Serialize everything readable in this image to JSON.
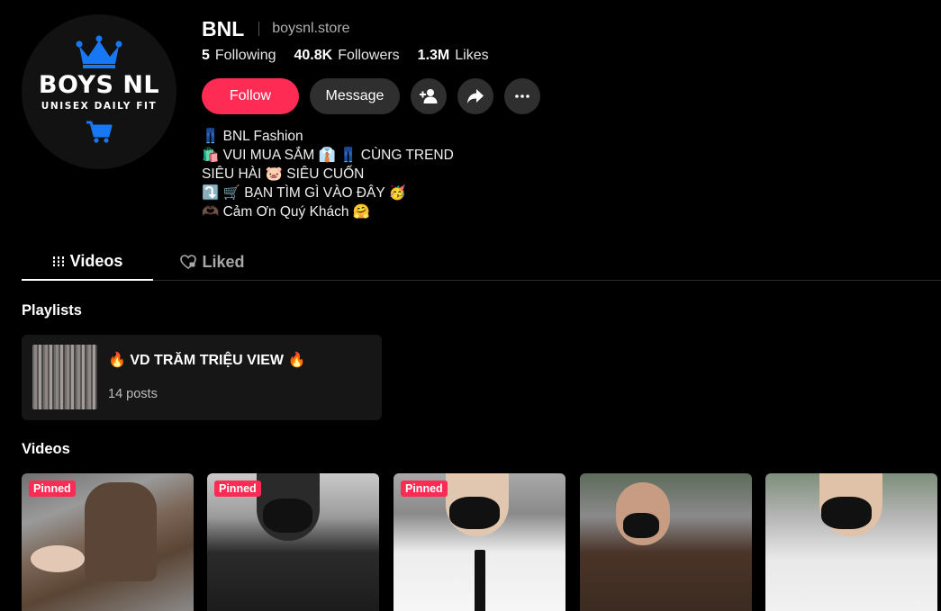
{
  "profile": {
    "avatar_brand": "BOYS NL",
    "avatar_tagline": "UNISEX DAILY FIT",
    "name": "BNL",
    "handle": "boysnl.store"
  },
  "stats": {
    "following_count": "5",
    "following_label": "Following",
    "followers_count": "40.8K",
    "followers_label": "Followers",
    "likes_count": "1.3M",
    "likes_label": "Likes"
  },
  "actions": {
    "follow_label": "Follow",
    "message_label": "Message",
    "icons": [
      "add-friend-icon",
      "share-icon",
      "more-icon"
    ]
  },
  "bio": [
    "👖 BNL Fashion",
    "🛍️ VUI MUA SẮM 👔 👖 CÙNG TREND",
    "SIÊU HÀI 🐷 SIÊU CUỐN",
    "⤵️ 🛒 BẠN TÌM GÌ VÀO ĐÂY 🥳",
    "🫶🏿 Cảm Ơn Quý Khách 🤗"
  ],
  "tabs": [
    {
      "label": "Videos",
      "active": true
    },
    {
      "label": "Liked",
      "active": false
    }
  ],
  "playlists": {
    "section_title": "Playlists",
    "items": [
      {
        "title": "🔥 VD TRĂM TRIỆU VIEW 🔥",
        "count": "14 posts"
      }
    ]
  },
  "videos": {
    "section_title": "Videos",
    "pinned_label": "Pinned",
    "items": [
      {
        "pinned": true
      },
      {
        "pinned": true
      },
      {
        "pinned": true
      },
      {
        "pinned": false
      },
      {
        "pinned": false
      }
    ]
  },
  "colors": {
    "accent": "#fe2c55",
    "brand_blue": "#1877f2",
    "background": "#000000"
  }
}
